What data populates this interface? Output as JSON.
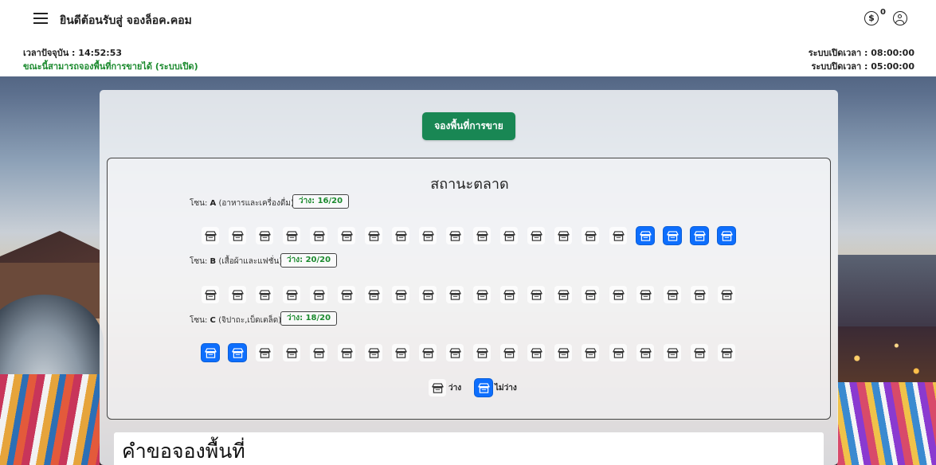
{
  "header": {
    "menu_icon": "hamburger-menu-icon",
    "title": "ยินดีต้อนรับสู่ จองล็อค.คอม",
    "coin_icon": "dollar-coin-icon",
    "coin_symbol": "$",
    "coin_count": "0",
    "user_icon": "user-circle-icon"
  },
  "status": {
    "current_time": "เวลาปัจจุบัน : 14:52:53",
    "booking_status": "ขณะนี้สามารถจองพื้นที่การขายได้ (ระบบเปิด)",
    "open_time": "ระบบเปิดเวลา : 08:00:00",
    "close_time": "ระบบปิดเวลา : 05:00:00",
    "status_color": "#1b8a2e"
  },
  "main": {
    "book_button": "จองพื้นที่การขาย",
    "market_title": "สถานะตลาด",
    "zones": [
      {
        "prefix": "โซน: ",
        "code": "A",
        "desc": " (อาหารและเครื่องดื่ม)",
        "badge": "ว่าง: 16/20",
        "stalls": [
          "free",
          "free",
          "free",
          "free",
          "free",
          "free",
          "free",
          "free",
          "free",
          "free",
          "free",
          "free",
          "free",
          "free",
          "free",
          "free",
          "taken",
          "taken",
          "taken",
          "taken"
        ]
      },
      {
        "prefix": "โซน: ",
        "code": "B",
        "desc": " (เสื้อผ้าและแฟชั่น)",
        "badge": "ว่าง: 20/20",
        "stalls": [
          "free",
          "free",
          "free",
          "free",
          "free",
          "free",
          "free",
          "free",
          "free",
          "free",
          "free",
          "free",
          "free",
          "free",
          "free",
          "free",
          "free",
          "free",
          "free",
          "free"
        ]
      },
      {
        "prefix": "โซน: ",
        "code": "C",
        "desc": " (จิปาถะ,เบ็ดเตล็ด)",
        "badge": "ว่าง: 18/20",
        "stalls": [
          "taken",
          "taken",
          "free",
          "free",
          "free",
          "free",
          "free",
          "free",
          "free",
          "free",
          "free",
          "free",
          "free",
          "free",
          "free",
          "free",
          "free",
          "free",
          "free",
          "free"
        ]
      }
    ],
    "stall_icon": "market-stall-icon",
    "legend": {
      "free": "ว่าง",
      "taken": "ไม่ว่าง"
    },
    "colors": {
      "taken": "#0d6efd",
      "button": "#198754"
    }
  },
  "request": {
    "title": "คำขอจองพื้นที่"
  }
}
